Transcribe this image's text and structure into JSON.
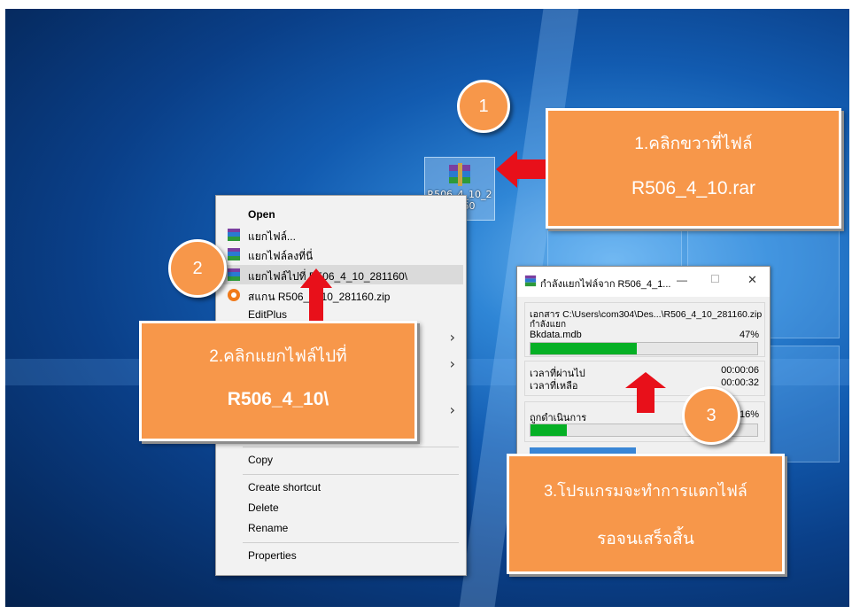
{
  "desktop_icon": {
    "label": "R506_4_10_281160",
    "icon": "winrar-archive-icon"
  },
  "context_menu": {
    "open": "Open",
    "extract_files": "แยกไฟล์...",
    "extract_here": "แยกไฟล์ลงที่นี่",
    "extract_to": "แยกไฟล์ไปที่ R506_4_10_281160\\",
    "scan": "สแกน R506_4_10_281160.zip",
    "editplus": "EditPlus",
    "copy": "Copy",
    "create_shortcut": "Create shortcut",
    "delete": "Delete",
    "rename": "Rename",
    "properties": "Properties",
    "submenu_arrow": "›"
  },
  "callouts": {
    "step1": {
      "number": "1",
      "line1": "1.คลิกขวาที่ไฟล์",
      "line2": "R506_4_10.rar"
    },
    "step2": {
      "number": "2",
      "line1": "2.คลิกแยกไฟล์ไปที่",
      "line2": "R506_4_10\\"
    },
    "step3": {
      "number": "3",
      "line1": "3.โปรแกรมจะทำการแตกไฟล์",
      "line2": "รอจนเสร็จสิ้น"
    }
  },
  "progress_dialog": {
    "title": "กำลังแยกไฟล์จาก R506_4_1...",
    "minimize": "—",
    "maximize": "☐",
    "close": "✕",
    "document_label": "เอกสาร C:\\Users\\com304\\Des...\\R506_4_10_281160.zip",
    "status": "กำลังแยก",
    "file_name": "Bkdata.mdb",
    "file_percent": "47%",
    "file_progress": 0.47,
    "elapsed_label": "เวลาที่ผ่านไป",
    "elapsed_value": "00:00:06",
    "remaining_label": "เวลาที่เหลือ",
    "remaining_value": "00:00:32",
    "processed_label": "ถูกดำเนินการ",
    "processed_percent": "16%",
    "processed_progress": 0.16
  },
  "colors": {
    "callout": "#f7974a",
    "arrow": "#e8101a",
    "progress": "#06b025"
  }
}
